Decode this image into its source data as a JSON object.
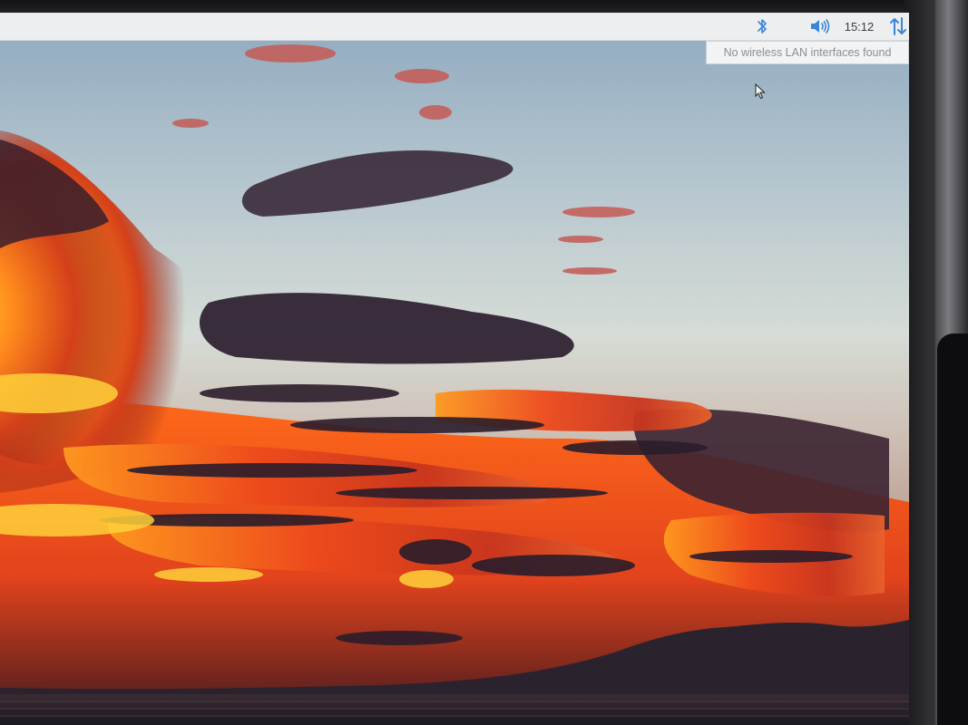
{
  "taskbar": {
    "tray": {
      "bluetooth_icon": "bluetooth-icon",
      "volume_icon": "speaker-volume-icon",
      "clock": "15:12",
      "network_icon": "network-updown-arrows-icon"
    },
    "accent_color": "#3a86d6"
  },
  "tooltip": {
    "text": "No wireless LAN interfaces found"
  },
  "desktop": {
    "wallpaper": "sunset-clouds-over-sea"
  }
}
